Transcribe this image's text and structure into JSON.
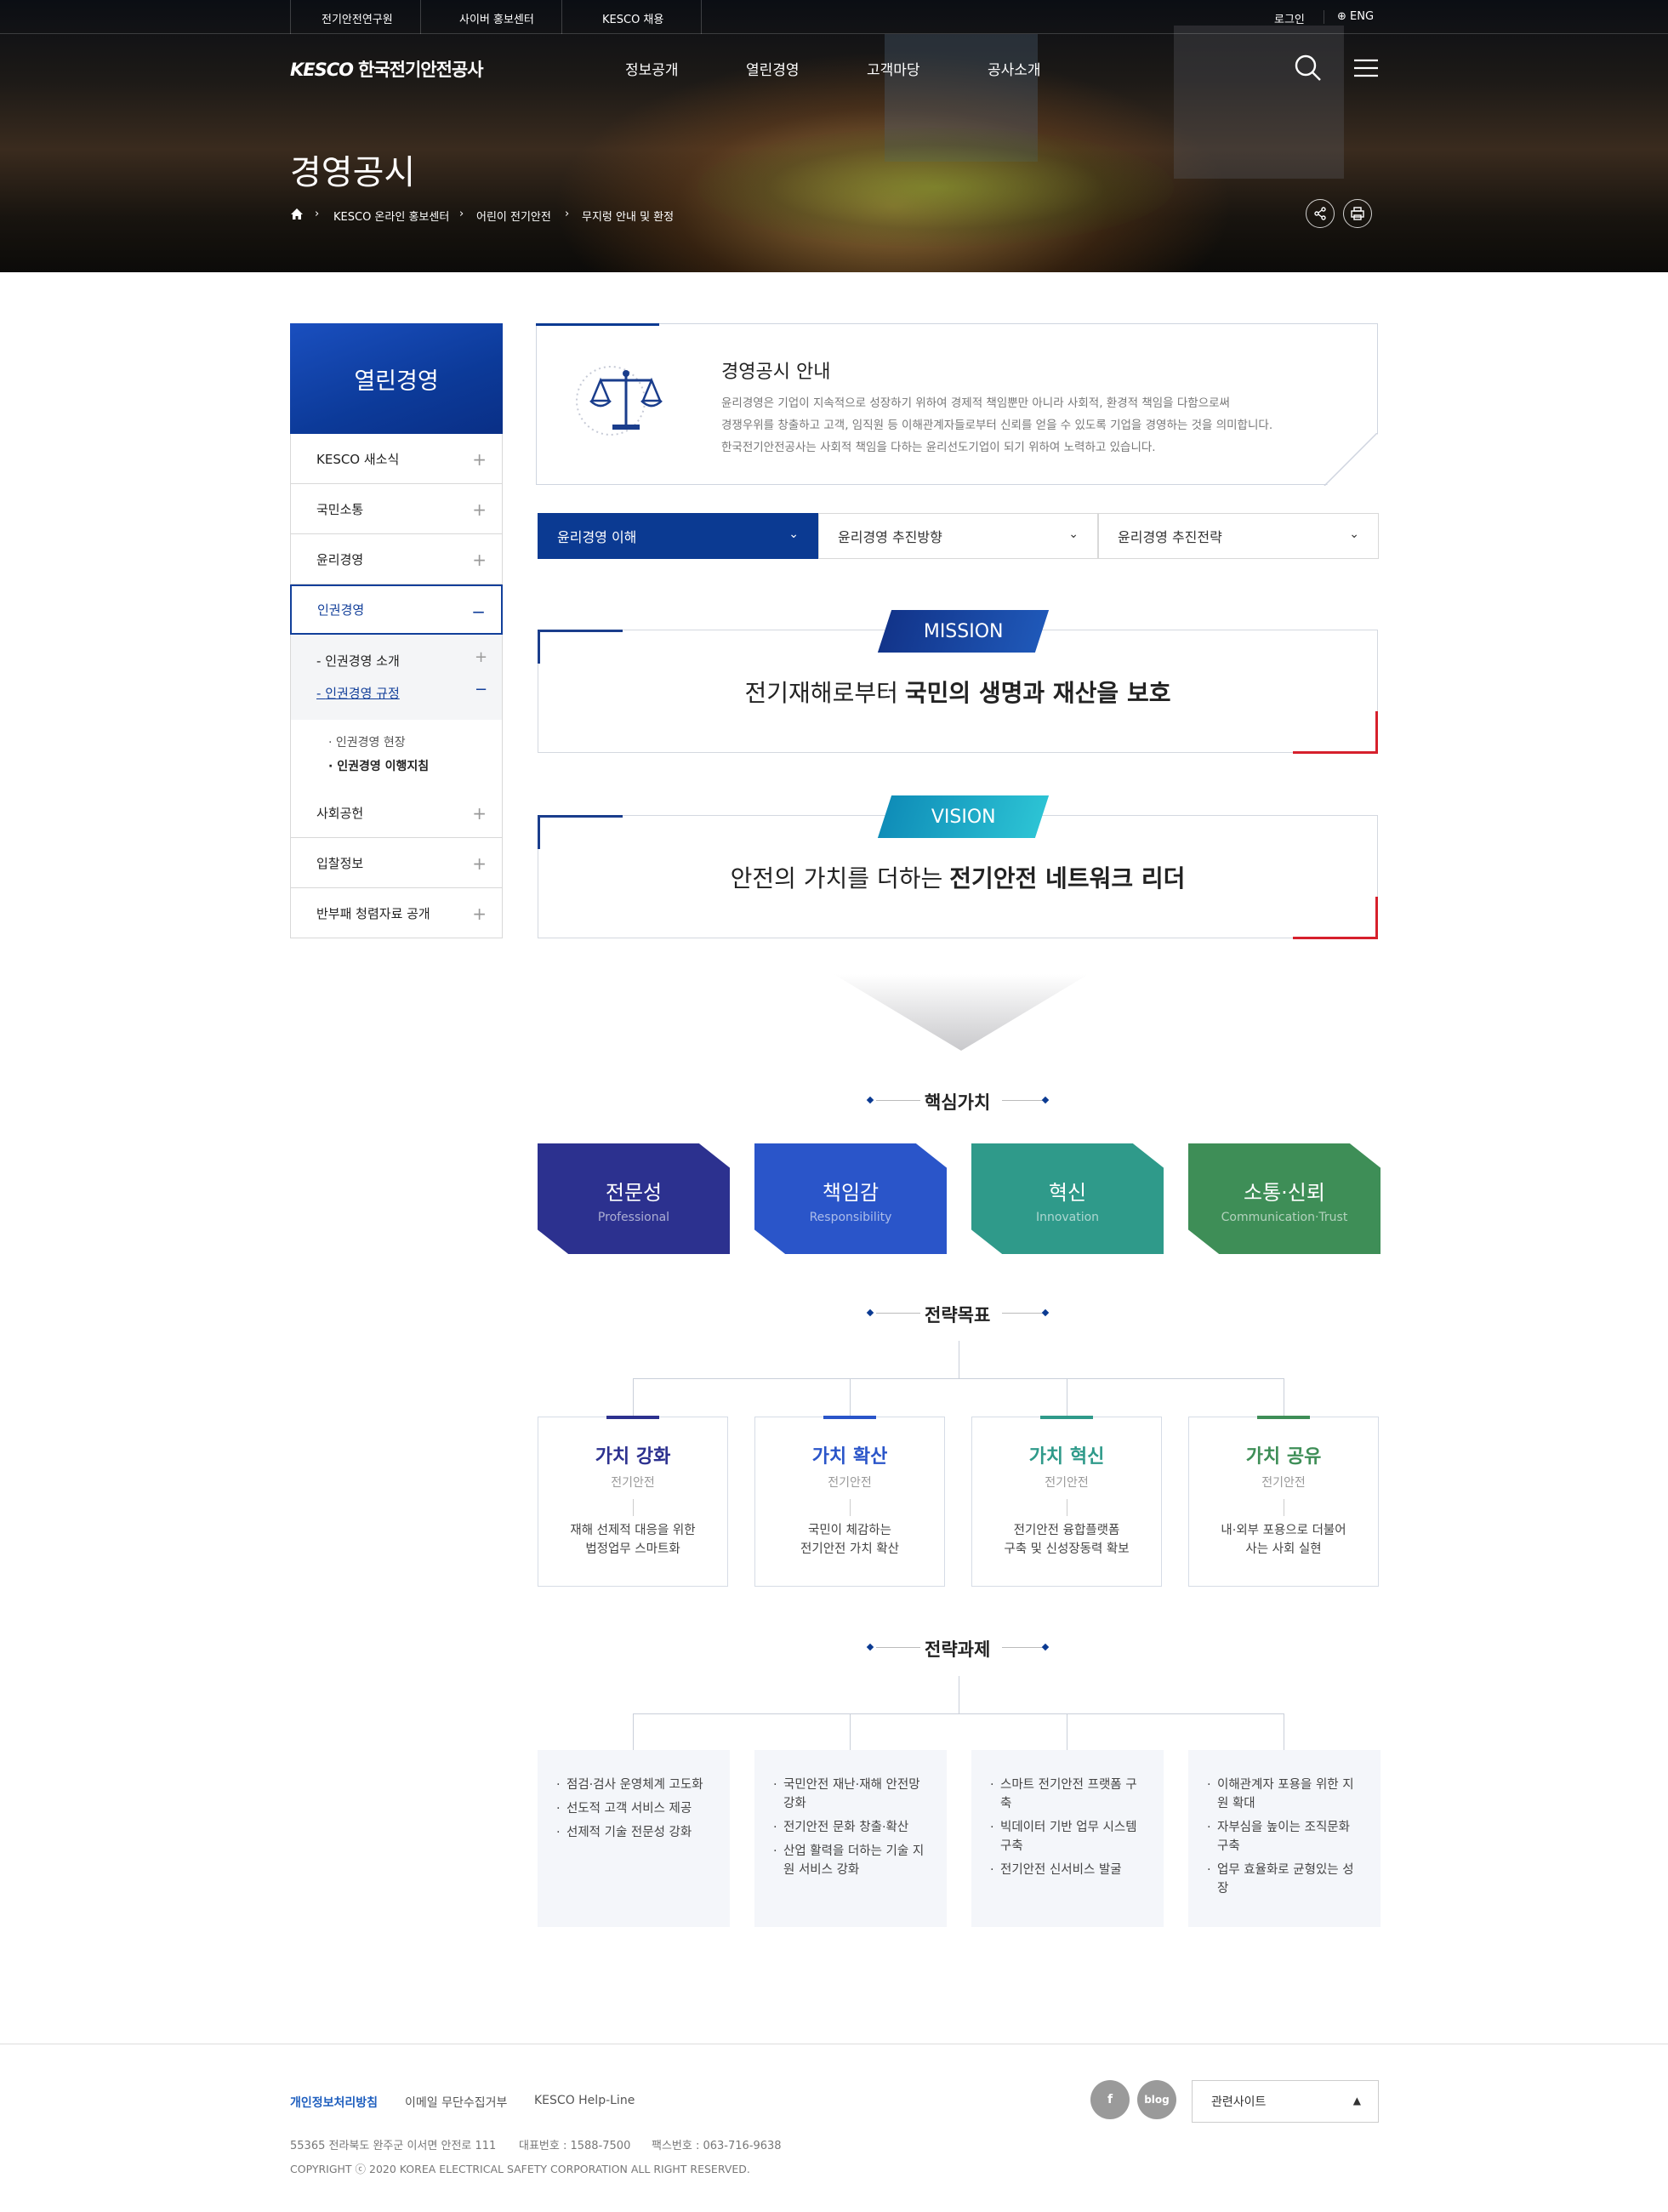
{
  "header": {
    "util_links": [
      "전기안전연구원",
      "사이버 홍보센터",
      "KESCO 채용"
    ],
    "login": "로그인",
    "lang": "ENG",
    "logo_en": "KESCO",
    "logo_kr": "한국전기안전공사",
    "gnb": [
      "정보공개",
      "열린경영",
      "고객마당",
      "공사소개"
    ],
    "page_title": "경영공시",
    "breadcrumb": [
      "KESCO 온라인 홍보센터",
      "어린이 전기안전",
      "무지렁 안내 및 환정"
    ]
  },
  "lnb": {
    "title": "열린경영",
    "items": [
      "KESCO 새소식",
      "국민소통",
      "윤리경영",
      "인권경영",
      "사회공헌",
      "입찰정보",
      "반부패 청렴자료 공개"
    ],
    "sub_items": [
      "인권경영 소개",
      "인권경영 규정"
    ],
    "sub_sub_items": [
      "인권경영 현장",
      "인권경영 이행지침"
    ]
  },
  "intro": {
    "title": "경영공시 안내",
    "lines": [
      "윤리경영은 기업이 지속적으로 성장하기 위하여 경제적 책임뿐만 아니라 사회적, 환경적 책임을 다함으로써",
      "경쟁우위를 창출하고 고객, 임직원 등 이해관계자들로부터 신뢰를 얻을 수 있도록 기업을 경영하는 것을 의미합니다.",
      "한국전기안전공사는 사회적 책임을 다하는 윤리선도기업이 되기 위하여 노력하고 있습니다."
    ]
  },
  "tabs": [
    "윤리경영 이해",
    "윤리경영 추진방향",
    "윤리경영 추진전략"
  ],
  "mission": {
    "tag": "MISSION",
    "text": "전기재해로부터",
    "bold": "국민의 생명과 재산을 보호"
  },
  "vision": {
    "tag": "VISION",
    "text": "안전의 가치를 더하는",
    "bold": "전기안전 네트워크 리더"
  },
  "core_values": {
    "title": "핵심가치",
    "items": [
      {
        "title": "전문성",
        "sub": "Professional"
      },
      {
        "title": "책임감",
        "sub": "Responsibility"
      },
      {
        "title": "혁신",
        "sub": "Innovation"
      },
      {
        "title": "소통·신뢰",
        "sub": "Communication·Trust"
      }
    ],
    "colors": [
      "#2c318f",
      "#2a55c9",
      "#2f9a8a",
      "#3e8e57"
    ]
  },
  "goals": {
    "title": "전략목표",
    "items": [
      {
        "title": "가치 강화",
        "sub": "전기안전",
        "desc1": "재해 선제적 대응을 위한",
        "desc2": "법정업무 스마트화"
      },
      {
        "title": "가치 확산",
        "sub": "전기안전",
        "desc1": "국민이 체감하는",
        "desc2": "전기안전 가치 확산"
      },
      {
        "title": "가치 혁신",
        "sub": "전기안전",
        "desc1": "전기안전 융합플랫폼",
        "desc2": "구축 및 신성장동력 확보"
      },
      {
        "title": "가치 공유",
        "sub": "전기안전",
        "desc1": "내·외부 포용으로 더불어",
        "desc2": "사는 사회 실현"
      }
    ],
    "colors": [
      "#2c318f",
      "#2a55c9",
      "#2f9a8a",
      "#3e8e57"
    ]
  },
  "tasks": {
    "title": "전략과제",
    "columns": [
      [
        "점검·검사 운영체계 고도화",
        "선도적 고객 서비스 제공",
        "선제적 기술 전문성 강화"
      ],
      [
        "국민안전 재난·재해 안전망 강화",
        "전기안전 문화 창출·확산",
        "산업 활력을 더하는 기술 지원 서비스 강화"
      ],
      [
        "스마트 전기안전 프랫폼 구축",
        "빅데이터 기반 업무 시스템 구축",
        "전기안전 신서비스 발굴"
      ],
      [
        "이해관계자 포용을 위한 지원 확대",
        "자부심을 높이는 조직문화 구축",
        "업무 효율화로 균형있는 성장"
      ]
    ]
  },
  "footer": {
    "links": [
      "개인정보처리방침",
      "이메일 무단수집거부",
      "KESCO Help-Line"
    ],
    "address": "55365 전라북도 완주군 이서면 안전로 111",
    "phone": "대표번호 : 1588-7500",
    "fax": "팩스번호 : 063-716-9638",
    "copyright": "COPYRIGHT ⓒ 2020 KOREA ELECTRICAL SAFETY CORPORATION ALL RIGHT RESERVED.",
    "sns": [
      "f",
      "blog"
    ],
    "related": "관련사이트"
  }
}
